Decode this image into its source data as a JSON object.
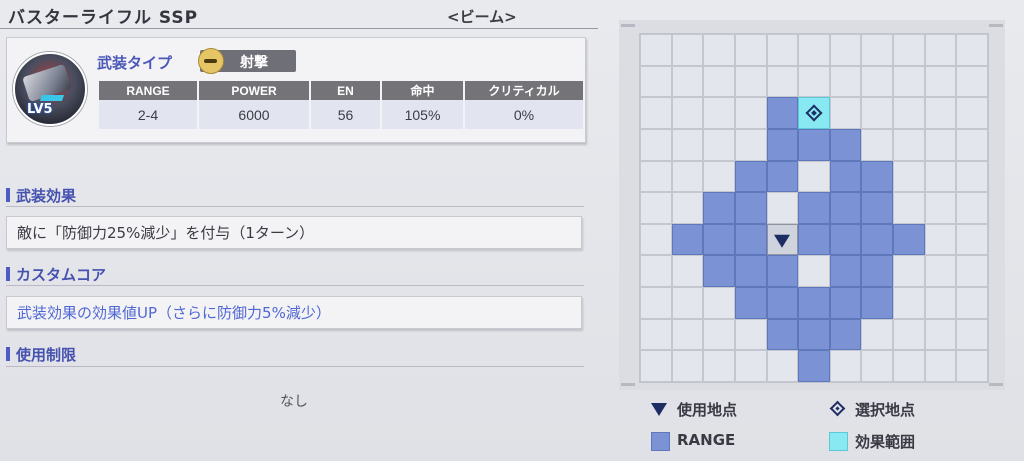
{
  "weapon": {
    "name": "バスターライフル SSP",
    "category": "<ビーム>"
  },
  "unit": {
    "level_badge": "LV5"
  },
  "type": {
    "label": "武装タイプ",
    "value": "射撃",
    "icon": "shooting-icon"
  },
  "stats": {
    "headers": [
      "RANGE",
      "POWER",
      "EN",
      "命中",
      "クリティカル"
    ],
    "values": [
      "2-4",
      "6000",
      "56",
      "105%",
      "0%"
    ]
  },
  "sections": {
    "effect_title": "武装効果",
    "effect_text": "敵に「防御力25%減少」を付与（1ターン）",
    "core_title": "カスタムコア",
    "core_text": "武装効果の効果値UP（さらに防御力5%減少）",
    "limit_title": "使用制限",
    "limit_text": "なし"
  },
  "range_grid": {
    "size": 11,
    "user": [
      5,
      4
    ],
    "target": [
      2,
      4
    ],
    "rows": [
      ".........",
      "...........",
      "....#......",
      "....###....",
      "...##.##...",
      "..##.###...",
      ".###U####..",
      "..###.##...",
      "...#####...",
      "....###....",
      ".....#....."
    ]
  },
  "legend": {
    "user_point": "使用地点",
    "select_point": "選択地点",
    "range": "RANGE",
    "effect_area": "効果範囲"
  },
  "colors": {
    "range": "#7b93d5",
    "effect": "#88e9f2",
    "accent": "#4652b0",
    "core_text": "#4f67d3"
  }
}
